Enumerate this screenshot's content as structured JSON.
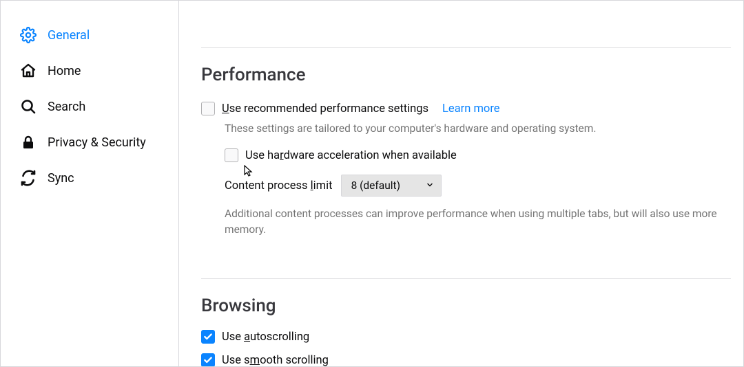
{
  "sidebar": {
    "items": [
      {
        "label": "General"
      },
      {
        "label": "Home"
      },
      {
        "label": "Search"
      },
      {
        "label": "Privacy & Security"
      },
      {
        "label": "Sync"
      }
    ]
  },
  "performance": {
    "title": "Performance",
    "use_recommended_label": "Use recommended performance settings",
    "learn_more": "Learn more",
    "tailored_desc": "These settings are tailored to your computer's hardware and operating system.",
    "hw_accel_label": "Use hardware acceleration when available",
    "process_limit_label": "Content process limit",
    "process_limit_value": "8 (default)",
    "process_desc": "Additional content processes can improve performance when using multiple tabs, but will also use more memory."
  },
  "browsing": {
    "title": "Browsing",
    "autoscroll_label": "Use autoscrolling",
    "smooth_label": "Use smooth scrolling"
  }
}
